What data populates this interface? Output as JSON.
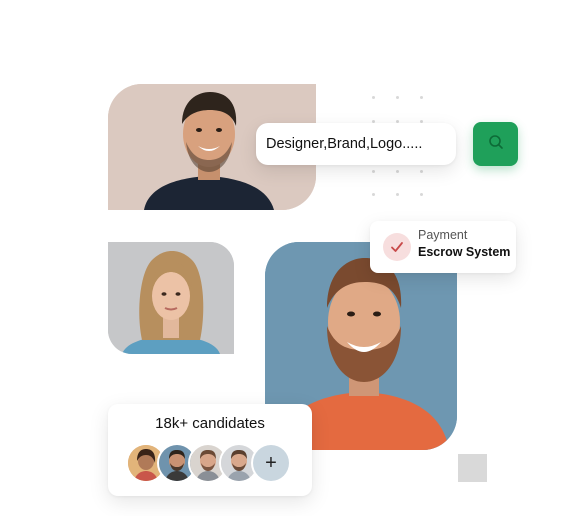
{
  "search": {
    "value": "Designer,Brand,Logo.....",
    "button_icon": "search-icon"
  },
  "escrow": {
    "caption": "Payment",
    "title": "Escrow System",
    "icon": "check-icon"
  },
  "candidates": {
    "title": "18k+ candidates",
    "add_label": "+"
  },
  "colors": {
    "accent_green": "#1fa05a",
    "escrow_check_bg": "#f7dede",
    "escrow_check": "#c84a4a"
  }
}
